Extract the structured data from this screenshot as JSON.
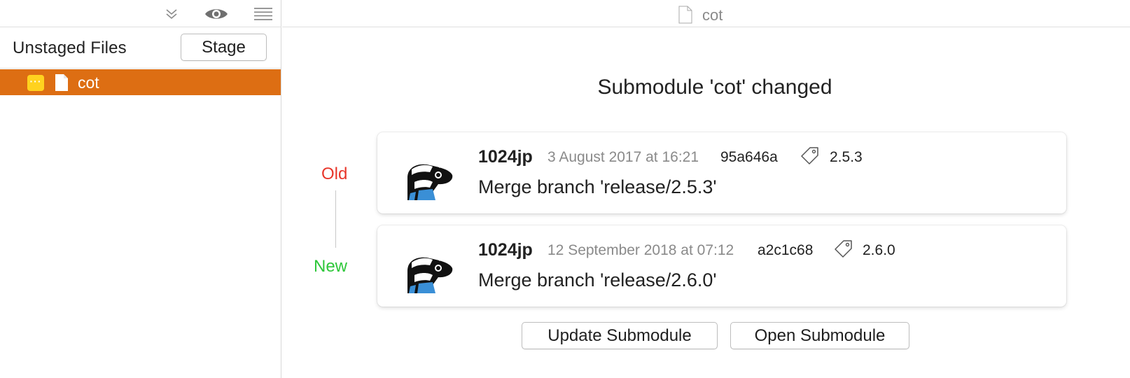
{
  "sidebar": {
    "toolbar": {
      "icons": [
        "double-chevron-down-icon",
        "eye-icon",
        "list-icon"
      ]
    },
    "section_title": "Unstaged Files",
    "stage_label": "Stage",
    "files": [
      {
        "name": "cot",
        "status_glyph": "···",
        "selected": true
      }
    ]
  },
  "main": {
    "title": "cot",
    "heading": "Submodule 'cot' changed",
    "labels": {
      "old": "Old",
      "new": "New"
    },
    "commits": [
      {
        "author": "1024jp",
        "date": "3 August 2017 at 16:21",
        "hash": "95a646a",
        "tag": "2.5.3",
        "message": "Merge branch 'release/2.5.3'"
      },
      {
        "author": "1024jp",
        "date": "12 September 2018 at 07:12",
        "hash": "a2c1c68",
        "tag": "2.6.0",
        "message": "Merge branch 'release/2.6.0'"
      }
    ],
    "buttons": {
      "update": "Update Submodule",
      "open": "Open Submodule"
    }
  },
  "colors": {
    "selection": "#dd6e13",
    "badge": "#ffd21f",
    "old": "#e8362a",
    "new": "#2ec73a"
  }
}
